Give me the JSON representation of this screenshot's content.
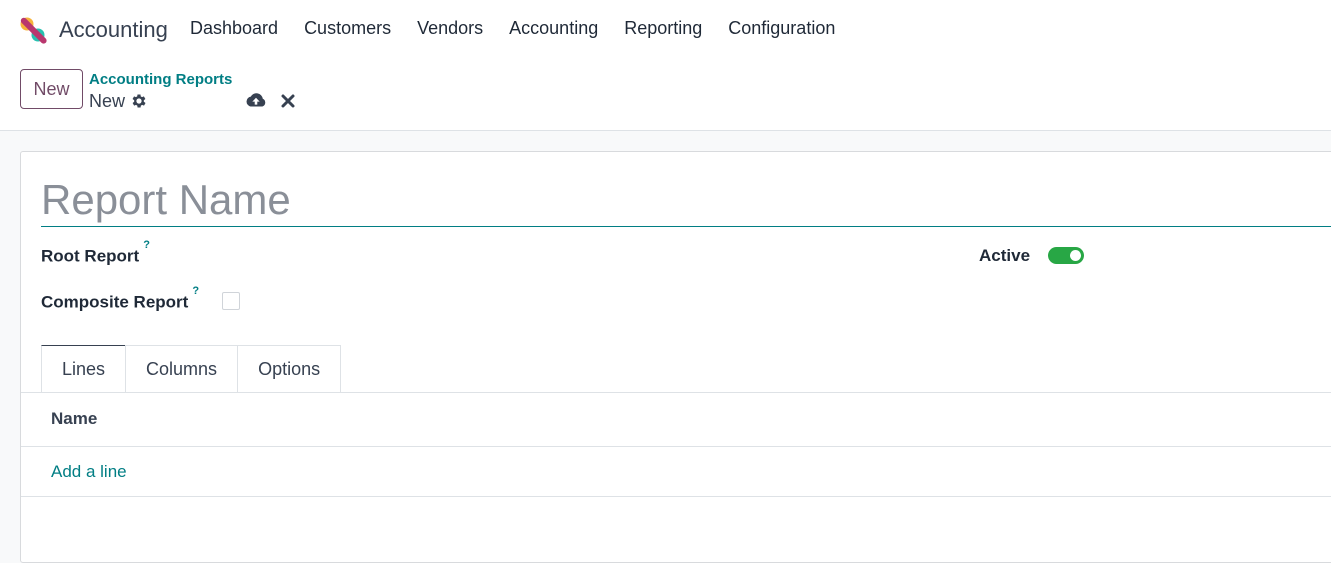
{
  "header": {
    "app_name": "Accounting",
    "nav": [
      "Dashboard",
      "Customers",
      "Vendors",
      "Accounting",
      "Reporting",
      "Configuration"
    ]
  },
  "control": {
    "new_label": "New",
    "breadcrumb_parent": "Accounting Reports",
    "breadcrumb_current": "New"
  },
  "form": {
    "report_name_placeholder": "Report Name",
    "report_name_value": "",
    "root_report_label": "Root Report",
    "composite_report_label": "Composite Report",
    "composite_report_checked": false,
    "active_label": "Active",
    "active_on": true,
    "help_mark": "?"
  },
  "tabs": [
    "Lines",
    "Columns",
    "Options"
  ],
  "lines_table": {
    "column_name": "Name",
    "add_line": "Add a line"
  },
  "colors": {
    "accent": "#017e84",
    "brand": "#714b67",
    "toggle_on": "#28a745"
  }
}
